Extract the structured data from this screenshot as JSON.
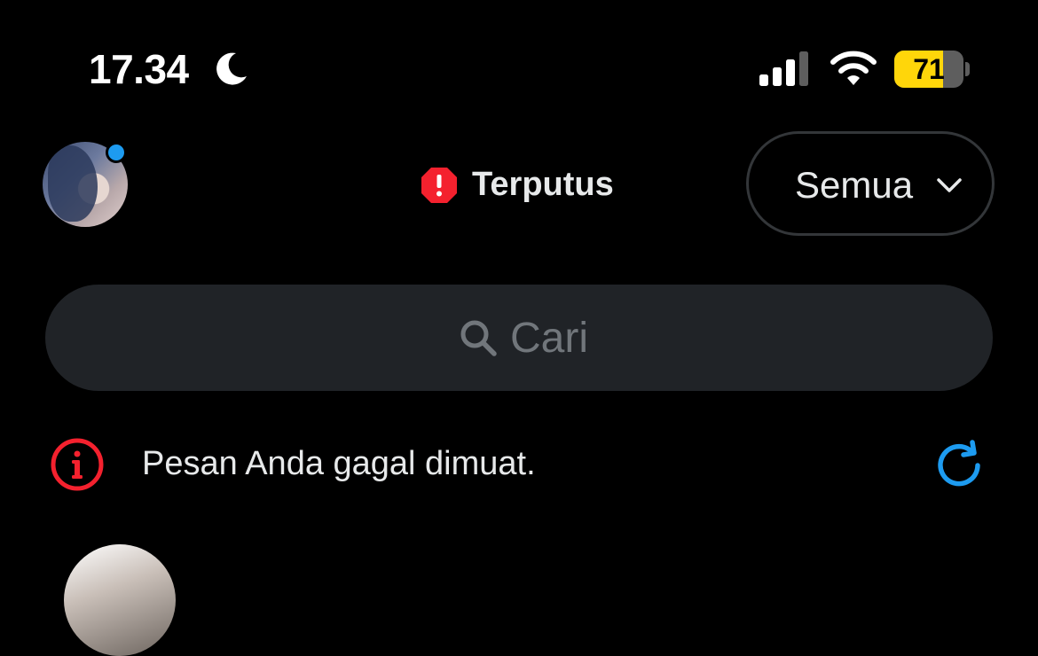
{
  "status_bar": {
    "time": "17.34",
    "battery_level": "71",
    "battery_fraction": 0.71,
    "icons": [
      "moon-icon",
      "signal-icon",
      "wifi-icon",
      "battery-icon"
    ]
  },
  "header": {
    "connection_status": "Terputus",
    "filter_label": "Semua"
  },
  "search": {
    "placeholder": "Cari"
  },
  "error_banner": {
    "message": "Pesan Anda gagal dimuat."
  },
  "colors": {
    "background": "#000000",
    "accent": "#1d9bf0",
    "error": "#f4212e",
    "battery": "#ffd60a",
    "search_bg": "#202327",
    "muted_text": "#71767b"
  }
}
